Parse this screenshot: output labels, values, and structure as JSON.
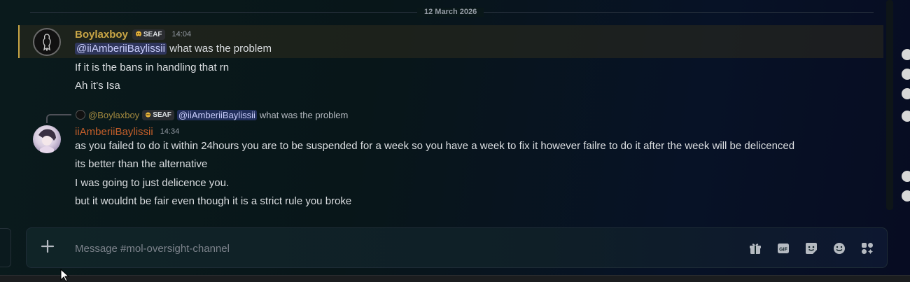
{
  "date_divider": "12 March 2026",
  "messages": [
    {
      "author": "Boylaxboy",
      "tag": "SEAF",
      "time": "14:04",
      "mention": "@iiAmberiiBaylissii",
      "lines": [
        "what was the problem",
        "If it is the bans in handling that rn",
        "Ah it’s Isa"
      ]
    },
    {
      "reply": {
        "author": "@Boylaxboy",
        "tag": "SEAF",
        "mention": "@iiAmberiiBaylissii",
        "text": "what was the problem"
      },
      "author": "iiAmberiiBaylissii",
      "time": "14:34",
      "lines": [
        "as you failed to do it within 24hours you are to be suspended for a week so you have a week to fix it however failre to do it after the week will be delicenced",
        "its better than the alternative",
        "I was going to just delicence you.",
        "but it wouldnt be fair even though it is a strict rule you broke"
      ]
    }
  ],
  "composer": {
    "placeholder": "Message #mol-oversight-channel",
    "buttons": [
      "gift-icon",
      "gif-icon",
      "sticker-icon",
      "emoji-icon",
      "apps-icon"
    ]
  },
  "colors": {
    "highlight_border": "#c9a646",
    "author1": "#c9a646",
    "author2": "#c25e2a",
    "mention_bg": "#3b4380"
  }
}
